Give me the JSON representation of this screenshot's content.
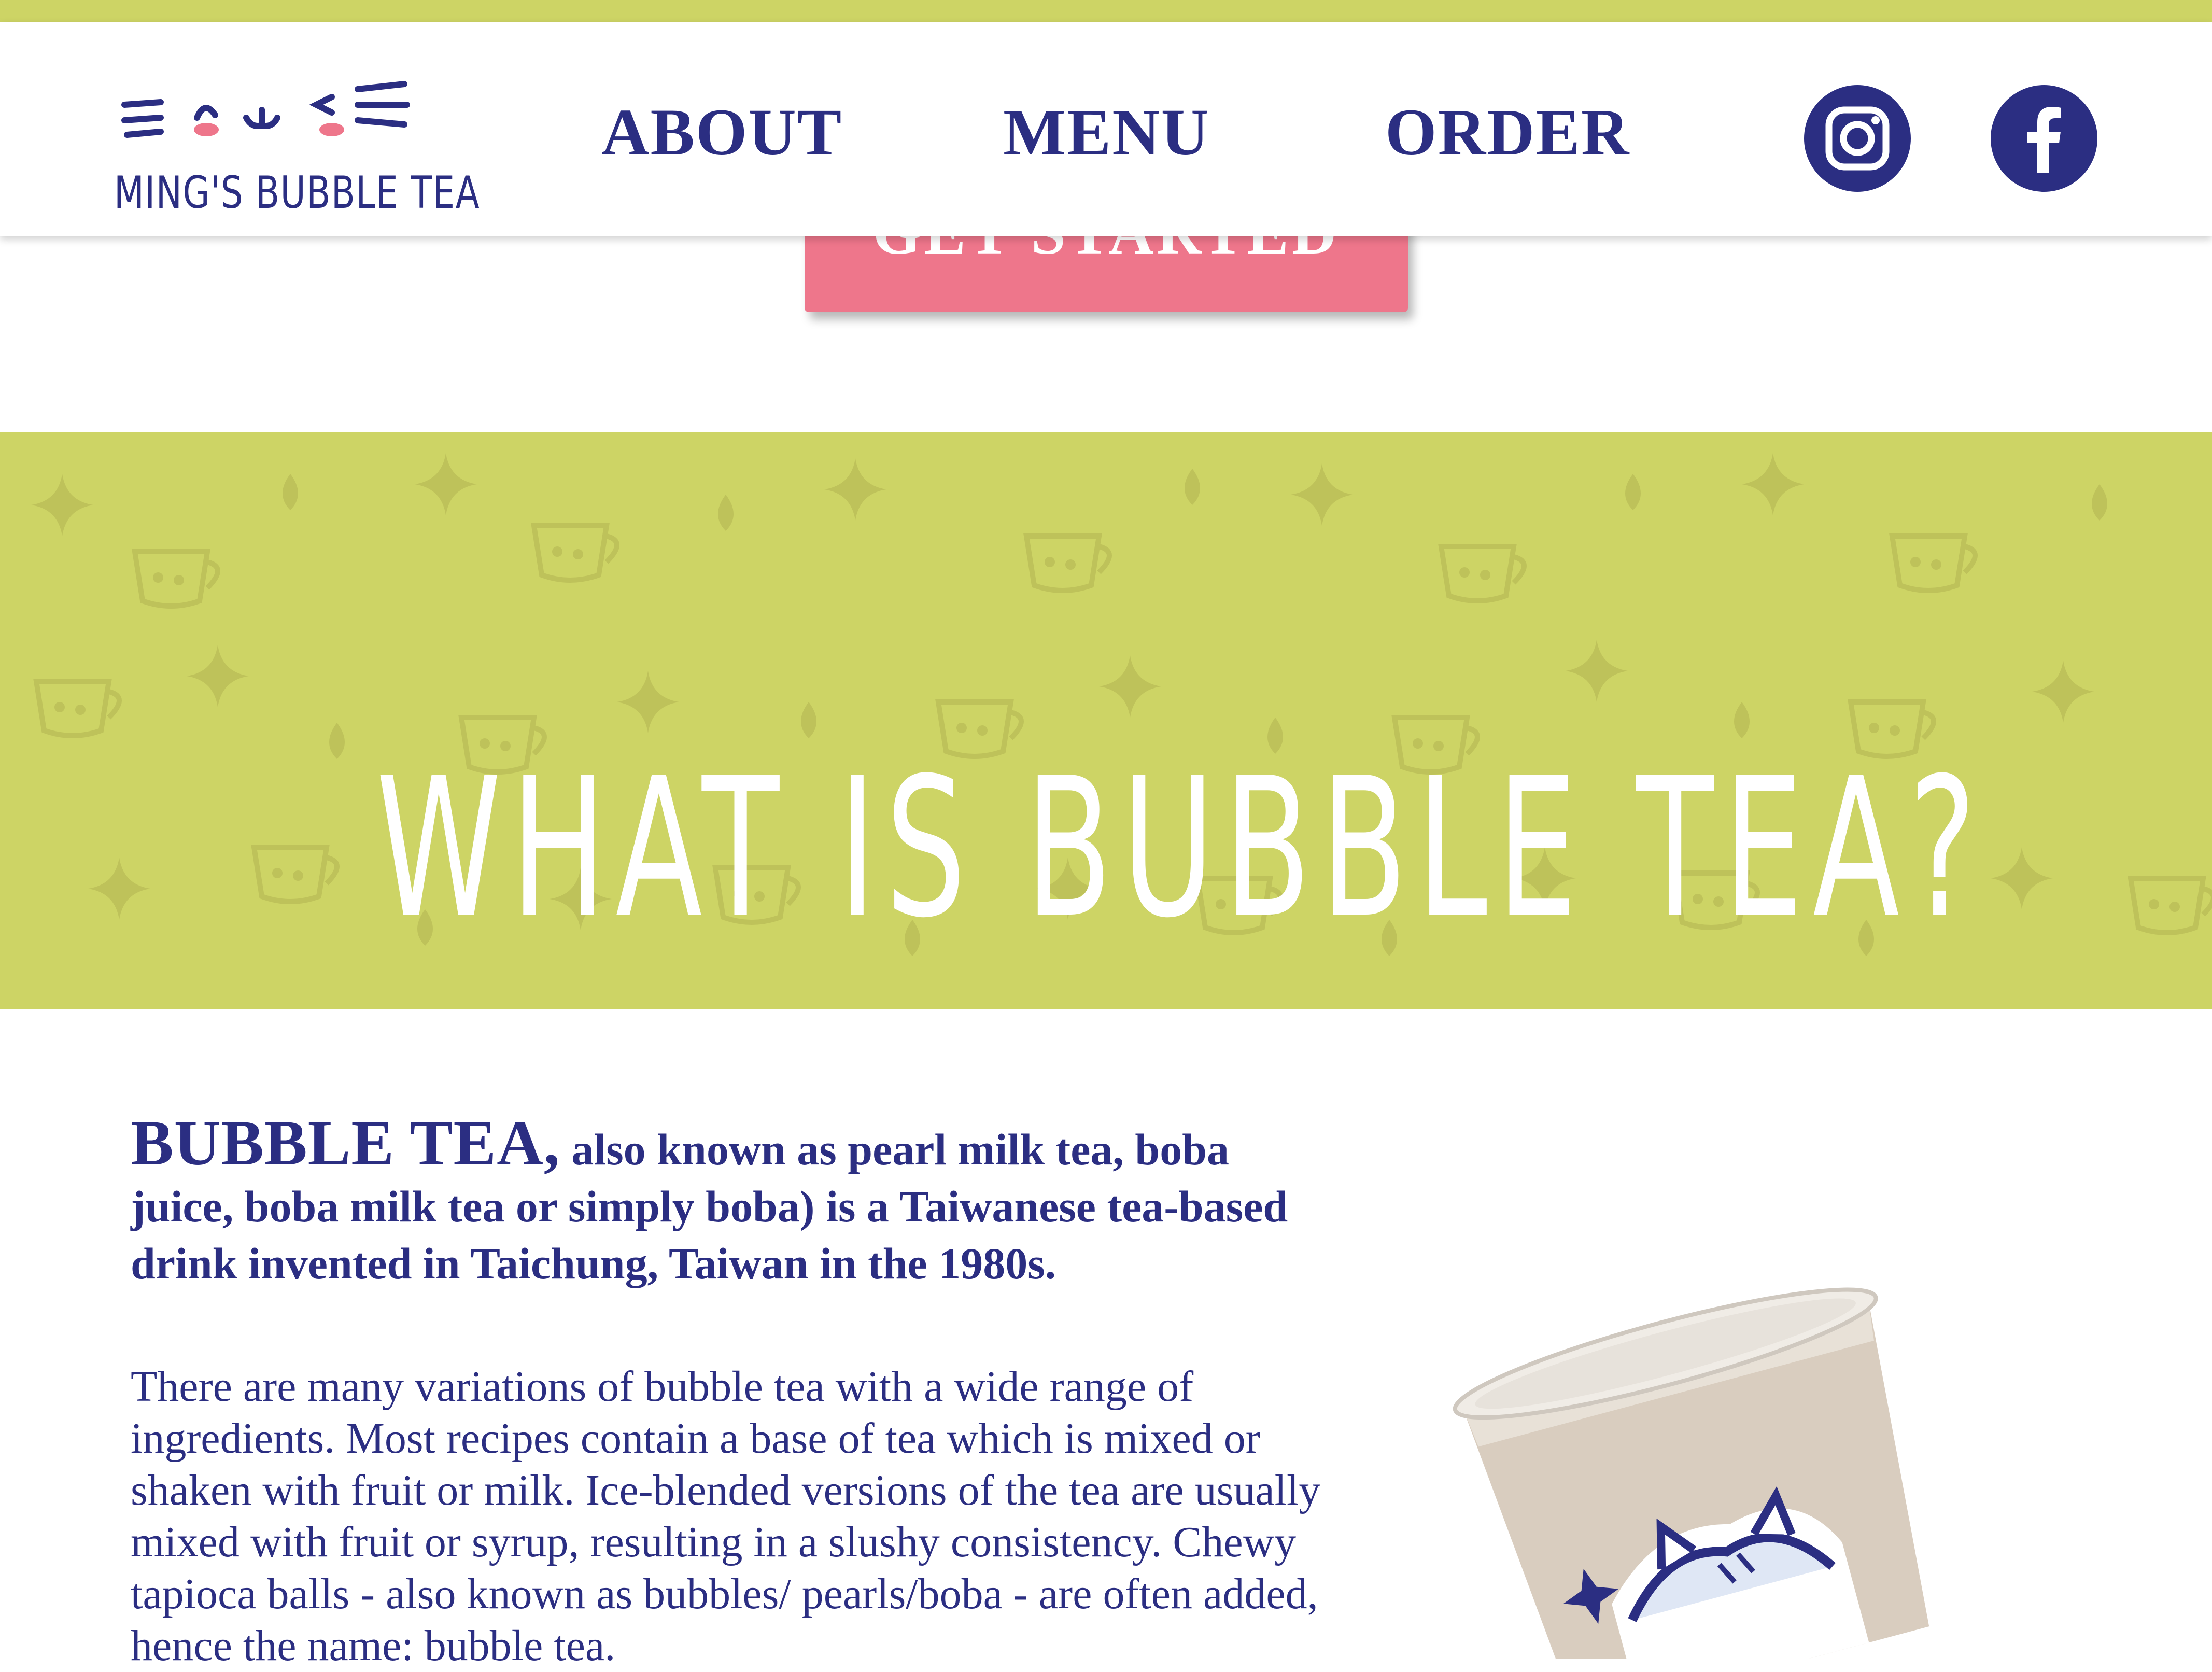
{
  "brand": {
    "name": "MING'S BUBBLE TEA"
  },
  "nav": {
    "links": [
      "ABOUT",
      "MENU",
      "ORDER"
    ]
  },
  "social": {
    "icons": [
      "instagram-icon",
      "facebook-icon"
    ]
  },
  "hero": {
    "cta_label": "GET STARTED"
  },
  "banner": {
    "title": "WHAT IS BUBBLE TEA?"
  },
  "content": {
    "intro_lead": "BUBBLE TEA,",
    "intro_rest": " also known as pearl milk tea, boba juice, boba milk tea or simply boba) is a Taiwanese tea-based drink invented in Taichung, Taiwan in the 1980s.",
    "body": "There are many variations of bubble tea with a wide range of ingredients. Most recipes contain a base of tea which is mixed or shaken with fruit or milk. Ice-blended versions of the tea are usually mixed with fruit or syrup, resulting in a slushy consistency. Chewy tapioca balls - also known as bubbles/ pearls/boba - are often added, hence the name: bubble tea."
  },
  "colors": {
    "brand_navy": "#2b2e82",
    "lime": "#cdd465",
    "pink": "#ee768b"
  }
}
